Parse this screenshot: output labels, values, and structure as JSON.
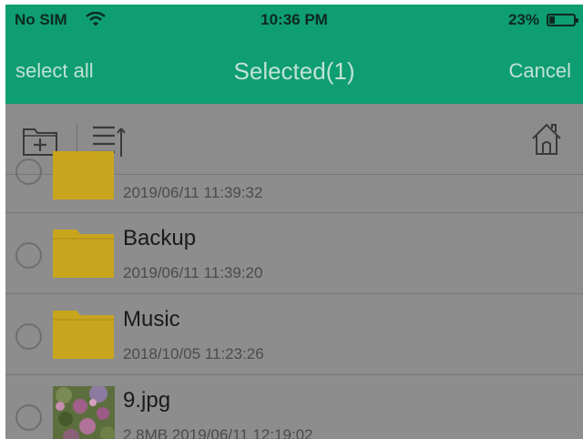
{
  "status_bar": {
    "carrier": "No SIM",
    "time": "10:36 PM",
    "battery": "23%",
    "battery_level": 0.23
  },
  "nav": {
    "select_all": "select all",
    "title": "Selected(1)",
    "cancel": "Cancel"
  },
  "toolbar": {
    "icons": [
      "new-folder-icon",
      "sort-icon",
      "home-icon"
    ]
  },
  "files": [
    {
      "name": "",
      "meta": "2019/06/11 11:39:32",
      "type": "folder"
    },
    {
      "name": "Backup",
      "meta": "2019/06/11 11:39:20",
      "type": "folder"
    },
    {
      "name": "Music",
      "meta": "2018/10/05 11:23:26",
      "type": "folder"
    },
    {
      "name": "9.jpg",
      "meta": "2.8MB 2019/06/11 12:19:02",
      "type": "image"
    }
  ],
  "colors": {
    "header": "#0f9d72",
    "folder": "#c9a51e",
    "overlay": "#8d8d8d"
  }
}
